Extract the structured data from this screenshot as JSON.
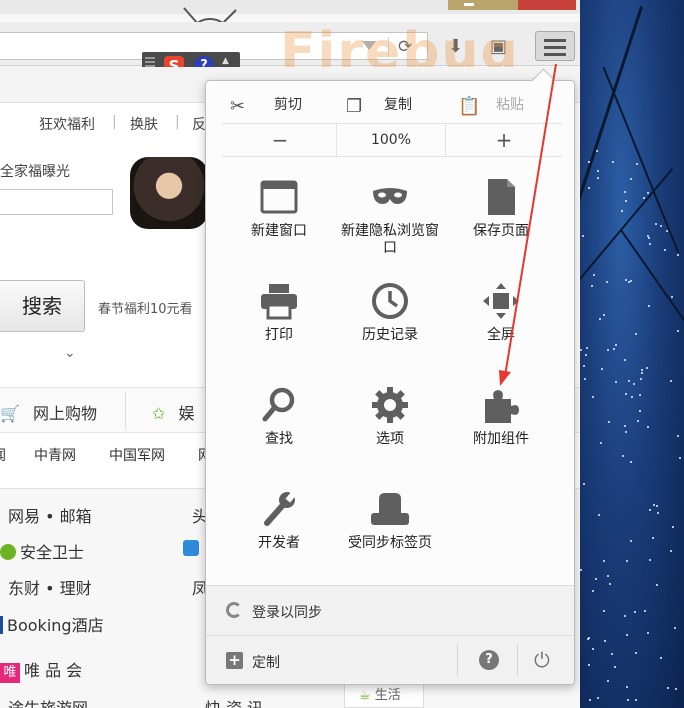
{
  "wallpaper": {
    "color": "#1a3c78"
  },
  "window": {
    "reload_icon": "reload-icon",
    "download_icon": "download-icon",
    "library_icon": "library-icon",
    "menu_icon": "hamburger-menu-icon"
  },
  "ime": {
    "logo": "S",
    "help": "?"
  },
  "page": {
    "nav": [
      "狂欢福利",
      "换肤",
      "反"
    ],
    "promo": "全家福曝光",
    "search_button": "搜索",
    "search_hint": "春节福利10元看",
    "categories": [
      {
        "label": "网上购物",
        "icon": "cart-icon"
      },
      {
        "label": "娱",
        "icon": "star-icon"
      }
    ],
    "site_row": [
      "闻",
      "中青网",
      "中国军网",
      "网"
    ],
    "sites_left": [
      "网易 • 邮箱",
      "安全卫士",
      "东财 • 理财",
      "Booking酒店",
      "唯 品 会",
      "途牛旅游网"
    ],
    "sites_right": [
      "头",
      "",
      "凤",
      "",
      "",
      "快 资 讯"
    ],
    "vip_badge": "唯",
    "life_label": "生活"
  },
  "menu": {
    "edit": {
      "cut": "剪切",
      "copy": "复制",
      "paste": "粘贴"
    },
    "zoom": {
      "minus": "−",
      "value": "100%",
      "plus": "+"
    },
    "items": [
      {
        "label": "新建窗口",
        "icon": "new-window-icon"
      },
      {
        "label": "新建隐私浏览窗口",
        "icon": "private-mask-icon"
      },
      {
        "label": "保存页面",
        "icon": "save-page-icon"
      },
      {
        "label": "打印",
        "icon": "printer-icon"
      },
      {
        "label": "历史记录",
        "icon": "history-clock-icon"
      },
      {
        "label": "全屏",
        "icon": "fullscreen-icon"
      },
      {
        "label": "查找",
        "icon": "find-magnifier-icon"
      },
      {
        "label": "选项",
        "icon": "options-gear-icon"
      },
      {
        "label": "附加组件",
        "icon": "addons-puzzle-icon"
      },
      {
        "label": "开发者",
        "icon": "developer-wrench-icon"
      },
      {
        "label": "受同步标签页",
        "icon": "synced-tabs-icon"
      }
    ],
    "sync_label": "登录以同步",
    "customize_label": "定制",
    "help_symbol": "?"
  },
  "annotation": {
    "color": "#e8352e"
  }
}
